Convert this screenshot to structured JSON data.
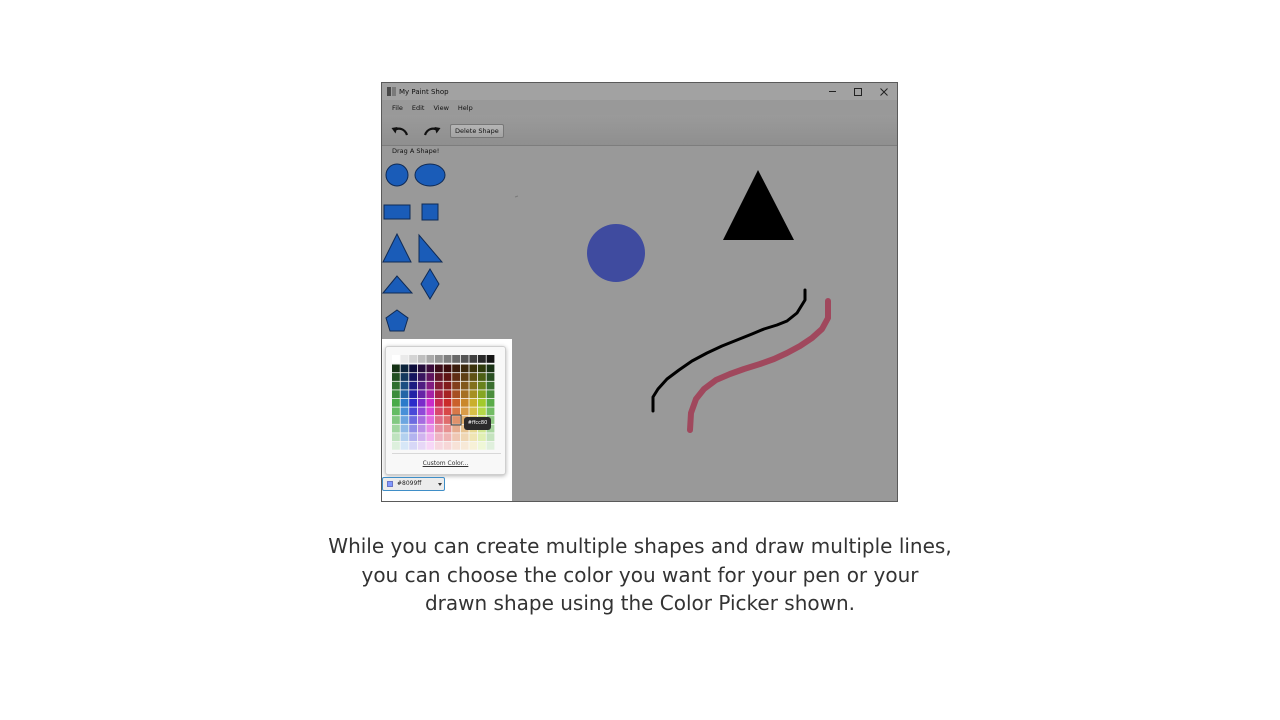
{
  "window": {
    "title": "My Paint Shop",
    "menu": [
      "File",
      "Edit",
      "View",
      "Help"
    ],
    "toolbar": {
      "undo_icon": "undo-arrow-icon",
      "redo_icon": "redo-arrow-icon",
      "delete_label": "Delete Shape"
    },
    "palette": {
      "label": "Drag A Shape!",
      "shape_color": "#1a5cb8",
      "shapes": [
        "circle",
        "ellipse",
        "rectangle",
        "square",
        "isosceles-triangle",
        "right-triangle",
        "wide-triangle",
        "diamond",
        "pentagon"
      ]
    },
    "canvas": {
      "background": "#999999",
      "items": [
        "black-triangle",
        "blue-circle",
        "black-line",
        "mauve-line"
      ]
    },
    "color_picker": {
      "hover_tooltip": "#ffcc80",
      "custom_label": "Custom Color...",
      "selected_value": "#8099ff",
      "selected_color": "#8099ff"
    }
  },
  "caption": {
    "line1": "While you can create multiple shapes and draw multiple lines,",
    "line2": "you can choose the color you want for your pen or your",
    "line3": "drawn shape using the Color Picker shown."
  }
}
